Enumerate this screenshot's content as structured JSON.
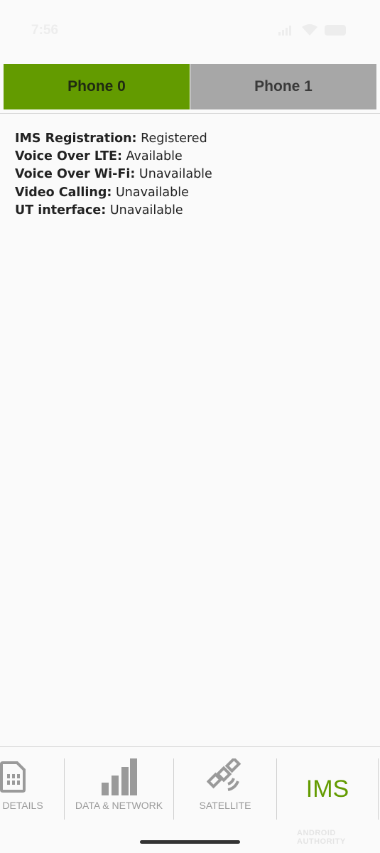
{
  "status_bar": {
    "time": "7:56",
    "icons": [
      "signal-icon",
      "wifi-icon",
      "battery-icon"
    ]
  },
  "phone_tabs": [
    {
      "label": "Phone 0",
      "active": true
    },
    {
      "label": "Phone 1",
      "active": false
    }
  ],
  "ims_info": [
    {
      "label": "IMS Registration:",
      "value": "Registered"
    },
    {
      "label": "Voice Over LTE:",
      "value": "Available"
    },
    {
      "label": "Voice Over Wi-Fi:",
      "value": "Unavailable"
    },
    {
      "label": "Video Calling:",
      "value": "Unavailable"
    },
    {
      "label": "UT interface:",
      "value": "Unavailable"
    }
  ],
  "bottom_nav": {
    "items": [
      {
        "label": "CE DETAILS",
        "icon": "sim-card-icon"
      },
      {
        "label": "DATA & NETWORK",
        "icon": "signal-bars-icon"
      },
      {
        "label": "SATELLITE",
        "icon": "satellite-icon"
      },
      {
        "label": "IMS",
        "active": true
      }
    ]
  },
  "watermark": "ANDROID AUTHORITY",
  "colors": {
    "accent_green": "#639b00",
    "inactive_tab": "#a7a7a7",
    "nav_icon": "#9a9a9a",
    "background": "#fafafa"
  }
}
